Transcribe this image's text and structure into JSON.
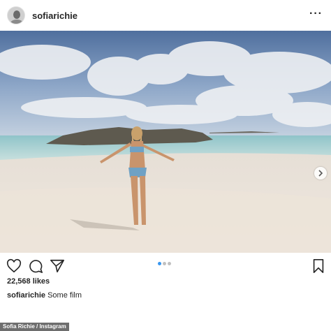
{
  "post": {
    "username": "sofiarichie",
    "more_label": "···",
    "likes": "22,568 likes",
    "caption_user": "sofiarichie",
    "caption_text": "Some film",
    "carousel_total": 3,
    "carousel_index": 1
  },
  "credit": {
    "text": "Sofia Richie / Instagram"
  },
  "icons": {
    "like": "heart-icon",
    "comment": "comment-icon",
    "share": "share-icon",
    "save": "bookmark-icon",
    "next": "chevron-right-icon"
  },
  "colors": {
    "carousel_active": "#3897f0",
    "carousel_inactive": "#c0c0c0"
  }
}
